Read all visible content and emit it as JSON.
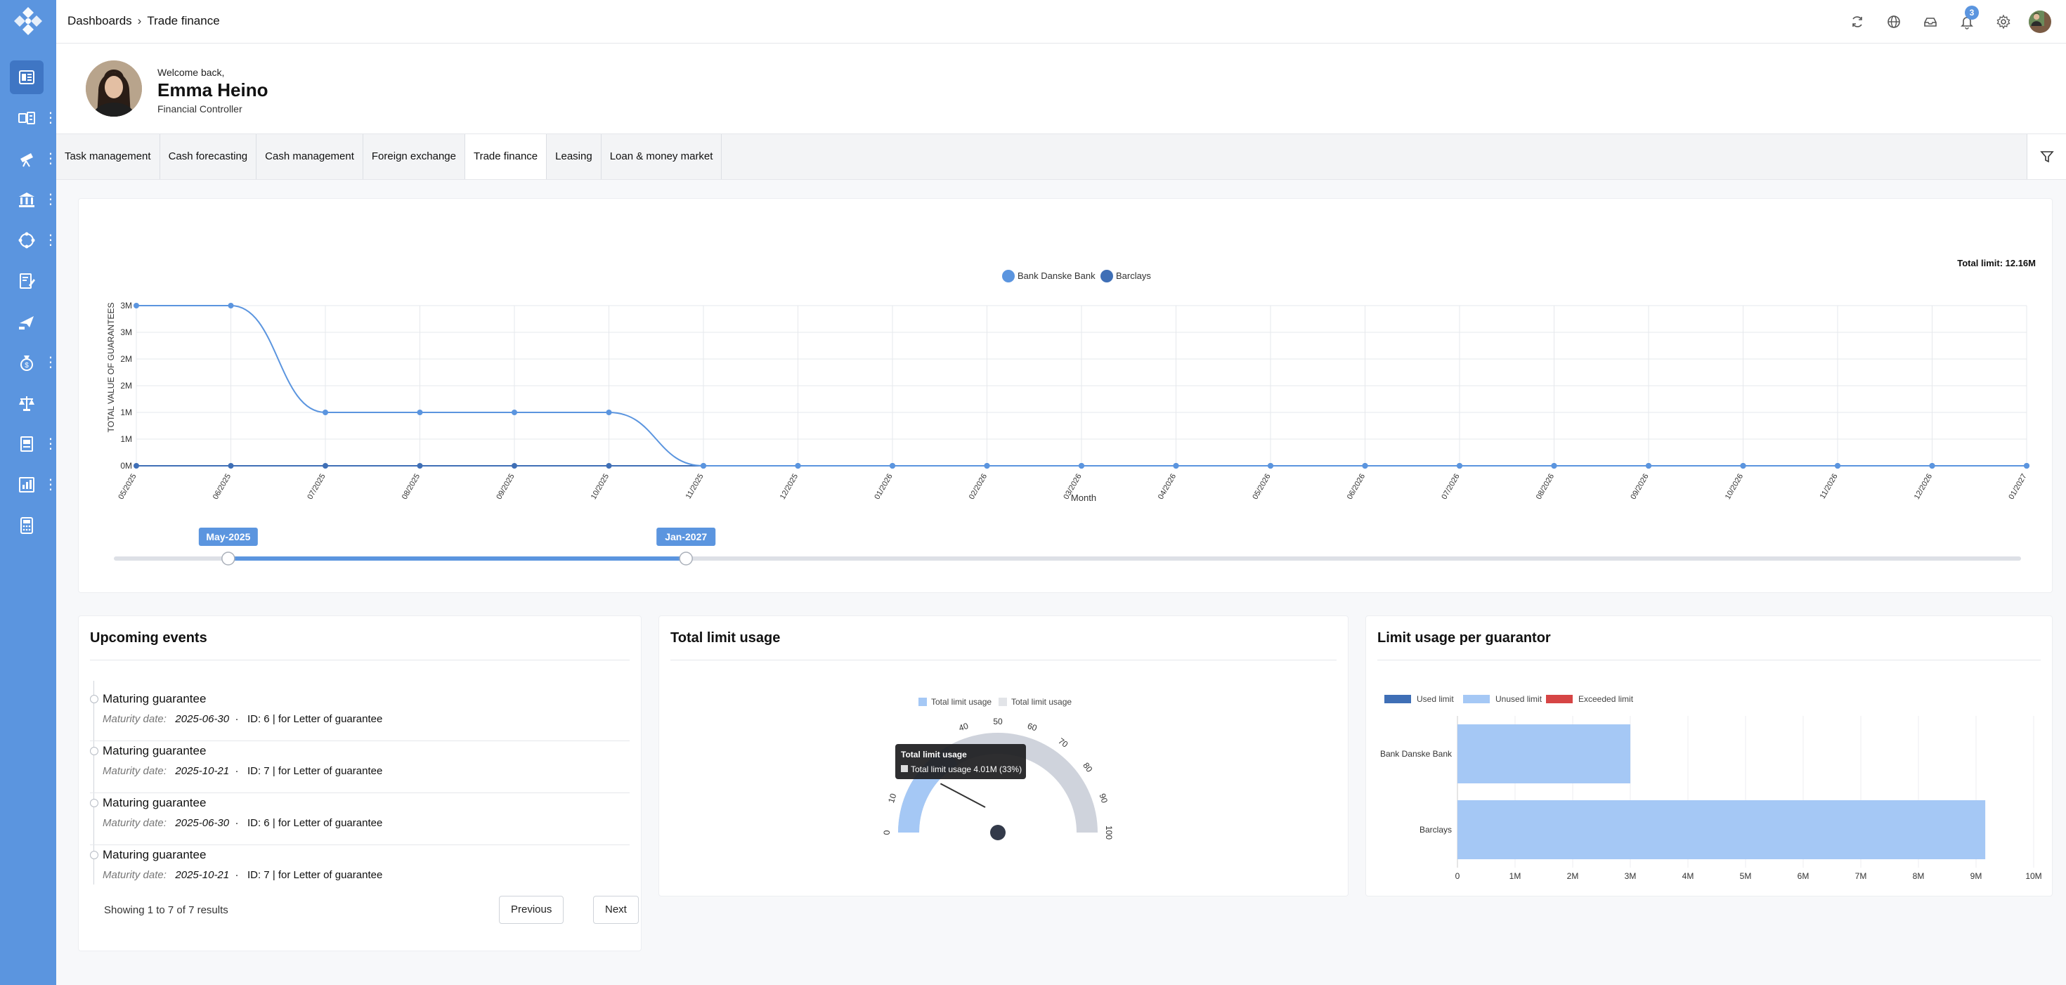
{
  "breadcrumb": {
    "root": "Dashboards",
    "current": "Trade finance"
  },
  "notifications": {
    "count": "3"
  },
  "welcome": {
    "greeting": "Welcome back,",
    "name": "Emma Heino",
    "role": "Financial Controller"
  },
  "tabs": [
    {
      "label": "Task management"
    },
    {
      "label": "Cash forecasting"
    },
    {
      "label": "Cash management"
    },
    {
      "label": "Foreign exchange"
    },
    {
      "label": "Trade finance",
      "active": true
    },
    {
      "label": "Leasing"
    },
    {
      "label": "Loan & money market"
    }
  ],
  "colors": {
    "sidebar": "#5b95df",
    "series_danske": "#5b95df",
    "series_barclays": "#3f6fb6",
    "unused": "#a5c8f5",
    "used": "#3f6fb6",
    "exceeded": "#d64545",
    "gauge_track": "#cfd3dc"
  },
  "guarantees_chart": {
    "chart_data": {
      "type": "line",
      "total_limit": "Total limit: 12.16M",
      "ylabel": "TOTAL VALUE OF GUARANTEES",
      "xlabel": "Month",
      "y_ticks": [
        "0M",
        "1M",
        "1M",
        "2M",
        "2M",
        "3M",
        "3M"
      ],
      "ylim": [
        0,
        3
      ],
      "categories": [
        "05/2025",
        "06/2025",
        "07/2025",
        "08/2025",
        "09/2025",
        "10/2025",
        "11/2025",
        "12/2025",
        "01/2026",
        "02/2026",
        "03/2026",
        "04/2026",
        "05/2026",
        "06/2026",
        "07/2026",
        "08/2026",
        "09/2026",
        "10/2026",
        "11/2026",
        "12/2026",
        "01/2027"
      ],
      "series": [
        {
          "name": "Bank Danske Bank",
          "values": [
            3,
            3,
            1,
            1,
            1,
            1,
            0,
            0,
            0,
            0,
            0,
            0,
            0,
            0,
            0,
            0,
            0,
            0,
            0,
            0,
            0
          ]
        },
        {
          "name": "Barclays",
          "values": [
            0,
            0,
            0,
            0,
            0,
            0,
            0,
            0,
            0,
            0,
            0,
            0,
            0,
            0,
            0,
            0,
            0,
            0,
            0,
            0,
            0
          ]
        }
      ]
    },
    "slider": {
      "start_label": "May-2025",
      "end_label": "Jan-2027",
      "start_fraction": 0.06,
      "end_fraction": 0.3
    }
  },
  "events": {
    "title": "Upcoming events",
    "maturity_label": "Maturity date:",
    "items": [
      {
        "title": "Maturing guarantee",
        "date": "2025-06-30",
        "info": "ID: 6 | for Letter of guarantee"
      },
      {
        "title": "Maturing guarantee",
        "date": "2025-10-21",
        "info": "ID: 7 | for Letter of guarantee"
      },
      {
        "title": "Maturing guarantee",
        "date": "2025-06-30",
        "info": "ID: 6 | for Letter of guarantee"
      },
      {
        "title": "Maturing guarantee",
        "date": "2025-10-21",
        "info": "ID: 7 | for Letter of guarantee"
      }
    ],
    "pager_text": "Showing 1 to 7 of 7 results",
    "prev_label": "Previous",
    "next_label": "Next"
  },
  "total_limit_usage": {
    "title": "Total limit usage",
    "chart_data": {
      "type": "gauge",
      "legend": [
        "Total limit usage",
        "Total limit usage"
      ],
      "ticks": [
        "0",
        "10",
        "40",
        "50",
        "60",
        "70",
        "80",
        "90",
        "100"
      ],
      "value_percent": 33,
      "tooltip_title": "Total limit usage",
      "tooltip_text": "Total limit usage 4.01M (33%)"
    }
  },
  "limit_per_guarantor": {
    "title": "Limit usage per guarantor",
    "chart_data": {
      "type": "bar",
      "orientation": "horizontal",
      "legend": [
        "Used limit",
        "Unused limit",
        "Exceeded limit"
      ],
      "categories": [
        "Bank Danske Bank",
        "Barclays"
      ],
      "series": [
        {
          "name": "Used limit",
          "values": [
            0,
            0
          ]
        },
        {
          "name": "Unused limit",
          "values": [
            3,
            9.16
          ]
        },
        {
          "name": "Exceeded limit",
          "values": [
            0,
            0
          ]
        }
      ],
      "x_ticks": [
        "0",
        "1M",
        "2M",
        "3M",
        "4M",
        "5M",
        "6M",
        "7M",
        "8M",
        "9M",
        "10M"
      ],
      "xlim": [
        0,
        10
      ]
    }
  }
}
